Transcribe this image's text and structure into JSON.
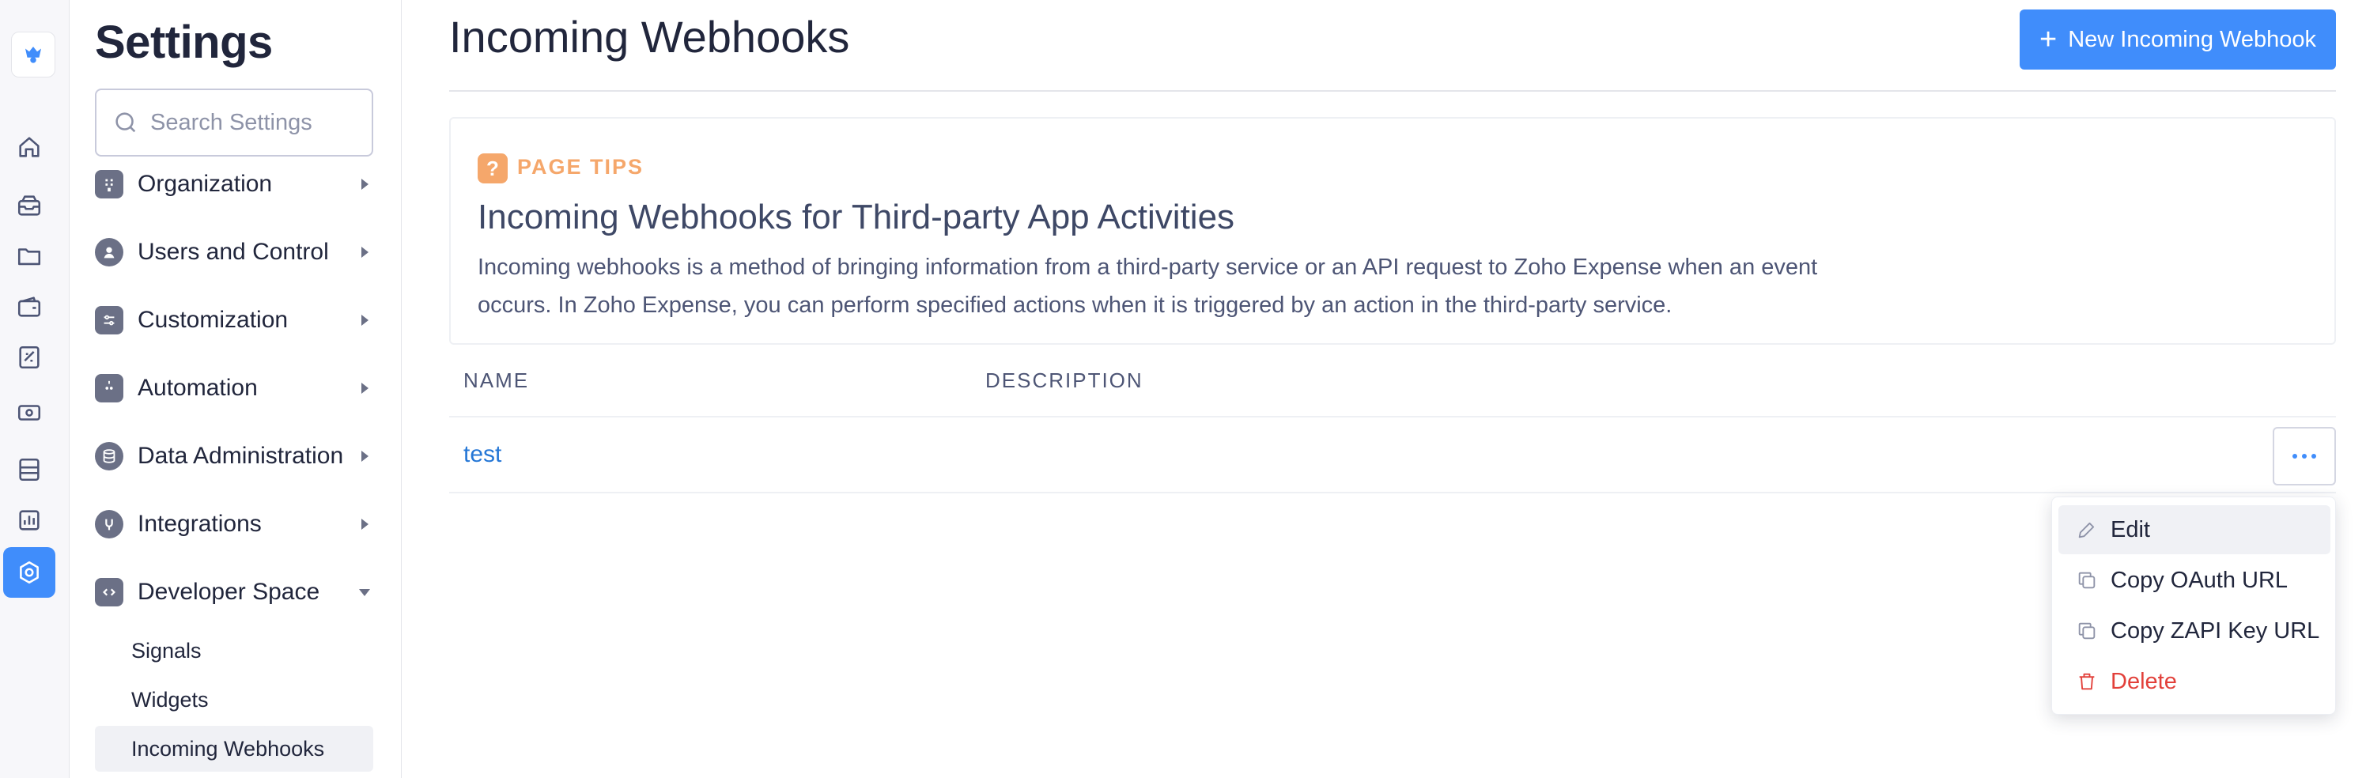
{
  "app": {
    "accent_color": "#408dfb",
    "rail_icons": [
      "logo-icon",
      "home-icon",
      "inbox-icon",
      "folder-icon",
      "wallet-icon",
      "receipt-icon",
      "cash-icon",
      "card-icon",
      "reports-icon",
      "settings-icon"
    ]
  },
  "sidebar": {
    "title": "Settings",
    "search_placeholder": "Search Settings",
    "sections": [
      {
        "label": "Organization",
        "icon": "building-icon"
      },
      {
        "label": "Users and Control",
        "icon": "user-icon"
      },
      {
        "label": "Customization",
        "icon": "sliders-icon"
      },
      {
        "label": "Automation",
        "icon": "robot-icon"
      },
      {
        "label": "Data Administration",
        "icon": "database-icon"
      },
      {
        "label": "Integrations",
        "icon": "plug-icon"
      },
      {
        "label": "Developer Space",
        "icon": "code-icon",
        "expanded": true
      }
    ],
    "sub_items": [
      {
        "label": "Signals"
      },
      {
        "label": "Widgets"
      },
      {
        "label": "Incoming Webhooks",
        "active": true
      }
    ]
  },
  "header": {
    "title": "Incoming Webhooks",
    "new_button_label": "New Incoming Webhook"
  },
  "tips": {
    "badge": "?",
    "label": "PAGE TIPS",
    "title": "Incoming Webhooks for Third-party App Activities",
    "body_line1": "Incoming webhooks is a method of bringing information from a third-party service or an API request to Zoho Expense when an event",
    "body_line2": "occurs. In Zoho Expense, you can perform specified actions when it is triggered by an action in the third-party service."
  },
  "table": {
    "columns": [
      "NAME",
      "DESCRIPTION"
    ],
    "rows": [
      {
        "name": "test",
        "description": ""
      }
    ]
  },
  "row_menu": {
    "items": [
      {
        "label": "Edit",
        "icon": "pencil-icon"
      },
      {
        "label": "Copy OAuth URL",
        "icon": "copy-icon"
      },
      {
        "label": "Copy ZAPI Key URL",
        "icon": "copy-icon"
      },
      {
        "label": "Delete",
        "icon": "trash-icon",
        "color": "#e2403a"
      }
    ]
  }
}
